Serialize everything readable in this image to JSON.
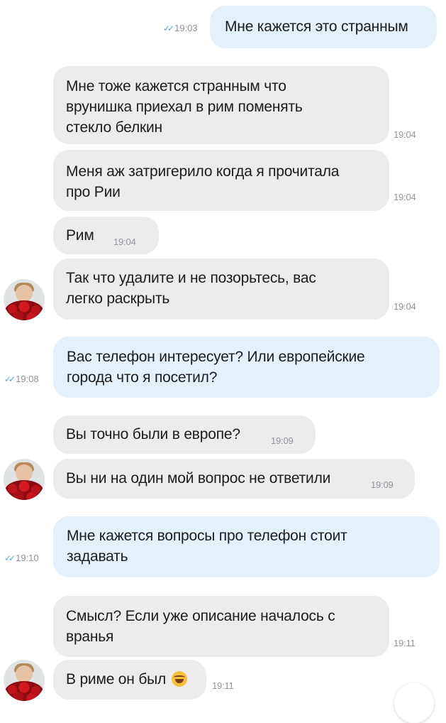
{
  "messages": [
    {
      "text": "Мне кажется это странным",
      "time": "19:03",
      "read": "✓✓"
    },
    {
      "text": "Мне тоже кажется странным что\nврунишка приехал в рим поменять\nстекло белкин",
      "time": "19:04"
    },
    {
      "text": "Меня аж затригерило когда я прочитала\nпро Рии",
      "time": "19:04"
    },
    {
      "text": "Рим",
      "time": "19:04"
    },
    {
      "text": "Так что удалите и не позорьтесь, вас\nлегко раскрыть",
      "time": "19:04"
    },
    {
      "text": "Вас телефон интересует? Или европейские\nгорода что я посетил?",
      "time": "19:08",
      "read": "✓✓"
    },
    {
      "text": "Вы точно были в европе?",
      "time": "19:09"
    },
    {
      "text": "Вы ни на один мой вопрос не ответили",
      "time": "19:09"
    },
    {
      "text": "Мне кажется вопросы про телефон стоит\nзадавать",
      "time": "19:10",
      "read": "✓✓"
    },
    {
      "text": "Смысл? Если уже описание началось с\nвранья",
      "time": "19:11"
    },
    {
      "text": "В риме он был",
      "time": "19:11",
      "emoji": "face-with-tears-of-joy-icon"
    }
  ]
}
